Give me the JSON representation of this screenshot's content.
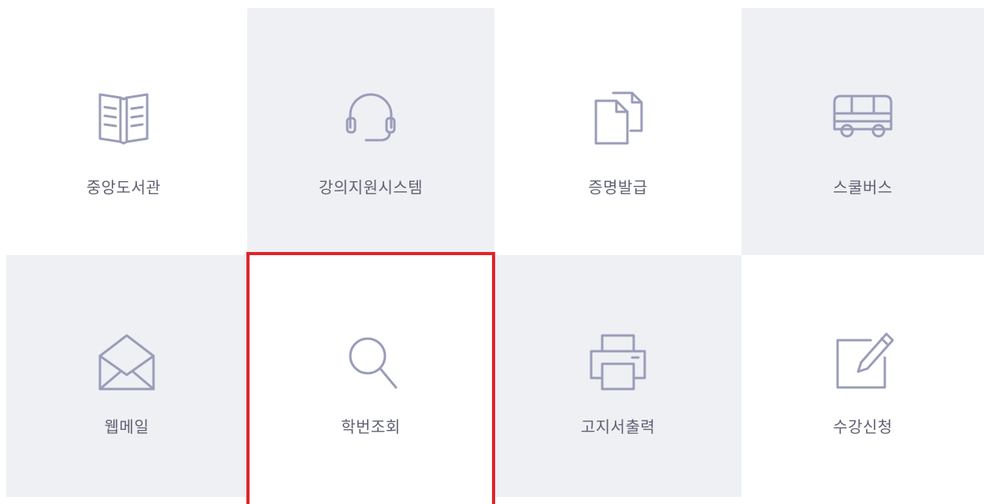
{
  "tiles": [
    {
      "label": "중앙도서관",
      "icon": "book-icon"
    },
    {
      "label": "강의지원시스템",
      "icon": "headset-icon"
    },
    {
      "label": "증명발급",
      "icon": "documents-icon"
    },
    {
      "label": "스쿨버스",
      "icon": "bus-icon"
    },
    {
      "label": "웹메일",
      "icon": "envelope-icon"
    },
    {
      "label": "학번조회",
      "icon": "search-icon"
    },
    {
      "label": "고지서출력",
      "icon": "printer-icon"
    },
    {
      "label": "수강신청",
      "icon": "edit-icon"
    }
  ],
  "colors": {
    "tile_shaded": "#eef0f4",
    "icon_stroke": "#9a9db8",
    "label_text": "#5f6172",
    "highlight_border": "#e0242b"
  }
}
